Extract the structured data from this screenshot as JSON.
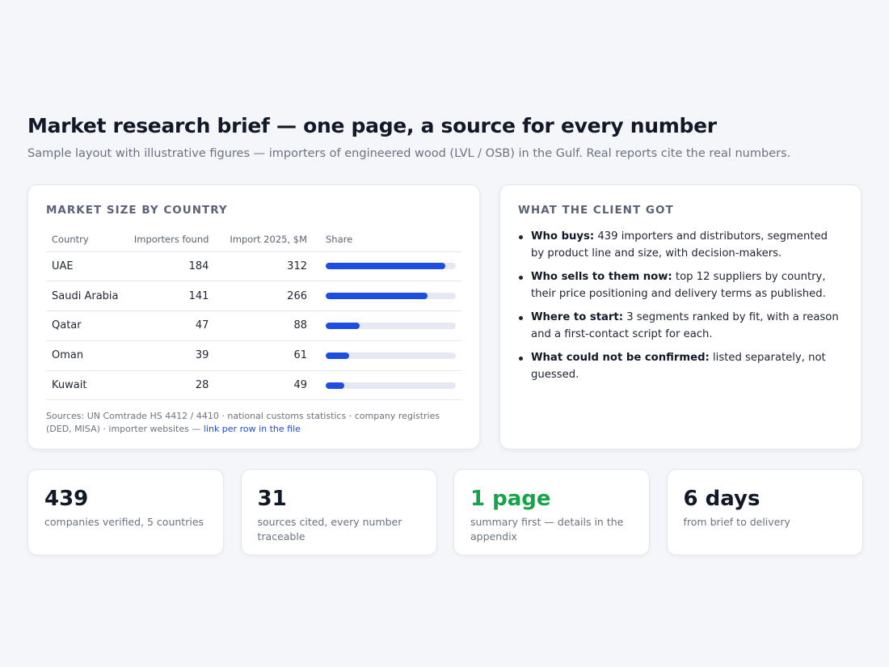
{
  "header": {
    "title": "Market research brief — one page, a source for every number",
    "subtitle": "Sample layout with illustrative figures — importers of engineered wood (LVL / OSB) in the Gulf. Real reports cite the real numbers."
  },
  "market": {
    "title": "MARKET SIZE BY COUNTRY",
    "columns": [
      "Country",
      "Importers found",
      "Import 2025, $M",
      "Share"
    ],
    "rows": [
      {
        "country": "UAE",
        "importers": "184",
        "import": "312",
        "share": 0.92
      },
      {
        "country": "Saudi Arabia",
        "importers": "141",
        "import": "266",
        "share": 0.78
      },
      {
        "country": "Qatar",
        "importers": "47",
        "import": "88",
        "share": 0.26
      },
      {
        "country": "Oman",
        "importers": "39",
        "import": "61",
        "share": 0.18
      },
      {
        "country": "Kuwait",
        "importers": "28",
        "import": "49",
        "share": 0.14
      }
    ],
    "bar_color": "#1d4ee0",
    "sources_text": "Sources: UN Comtrade HS 4412 / 4410 · national customs statistics · company registries (DED, MISA) · importer websites — ",
    "sources_link": "link per row in the file"
  },
  "client_got": {
    "title": "WHAT THE CLIENT GOT",
    "items": [
      {
        "label": "Who buys:",
        "text": " 439 importers and distributors, segmented by product line and size, with decision-makers."
      },
      {
        "label": "Who sells to them now:",
        "text": " top 12 suppliers by country, their price positioning and delivery terms as published."
      },
      {
        "label": "Where to start:",
        "text": " 3 segments ranked by fit, with a reason and a first-contact script for each."
      },
      {
        "label": "What could not be confirmed:",
        "text": " listed separately, not guessed."
      }
    ]
  },
  "stats": [
    {
      "value": "439",
      "label": "companies verified, 5 countries"
    },
    {
      "value": "31",
      "label": "sources cited, every number traceable"
    },
    {
      "value": "1 page",
      "label": "summary first — details in the appendix",
      "color": "#16a34a"
    },
    {
      "value": "6 days",
      "label": "from brief to delivery"
    }
  ]
}
